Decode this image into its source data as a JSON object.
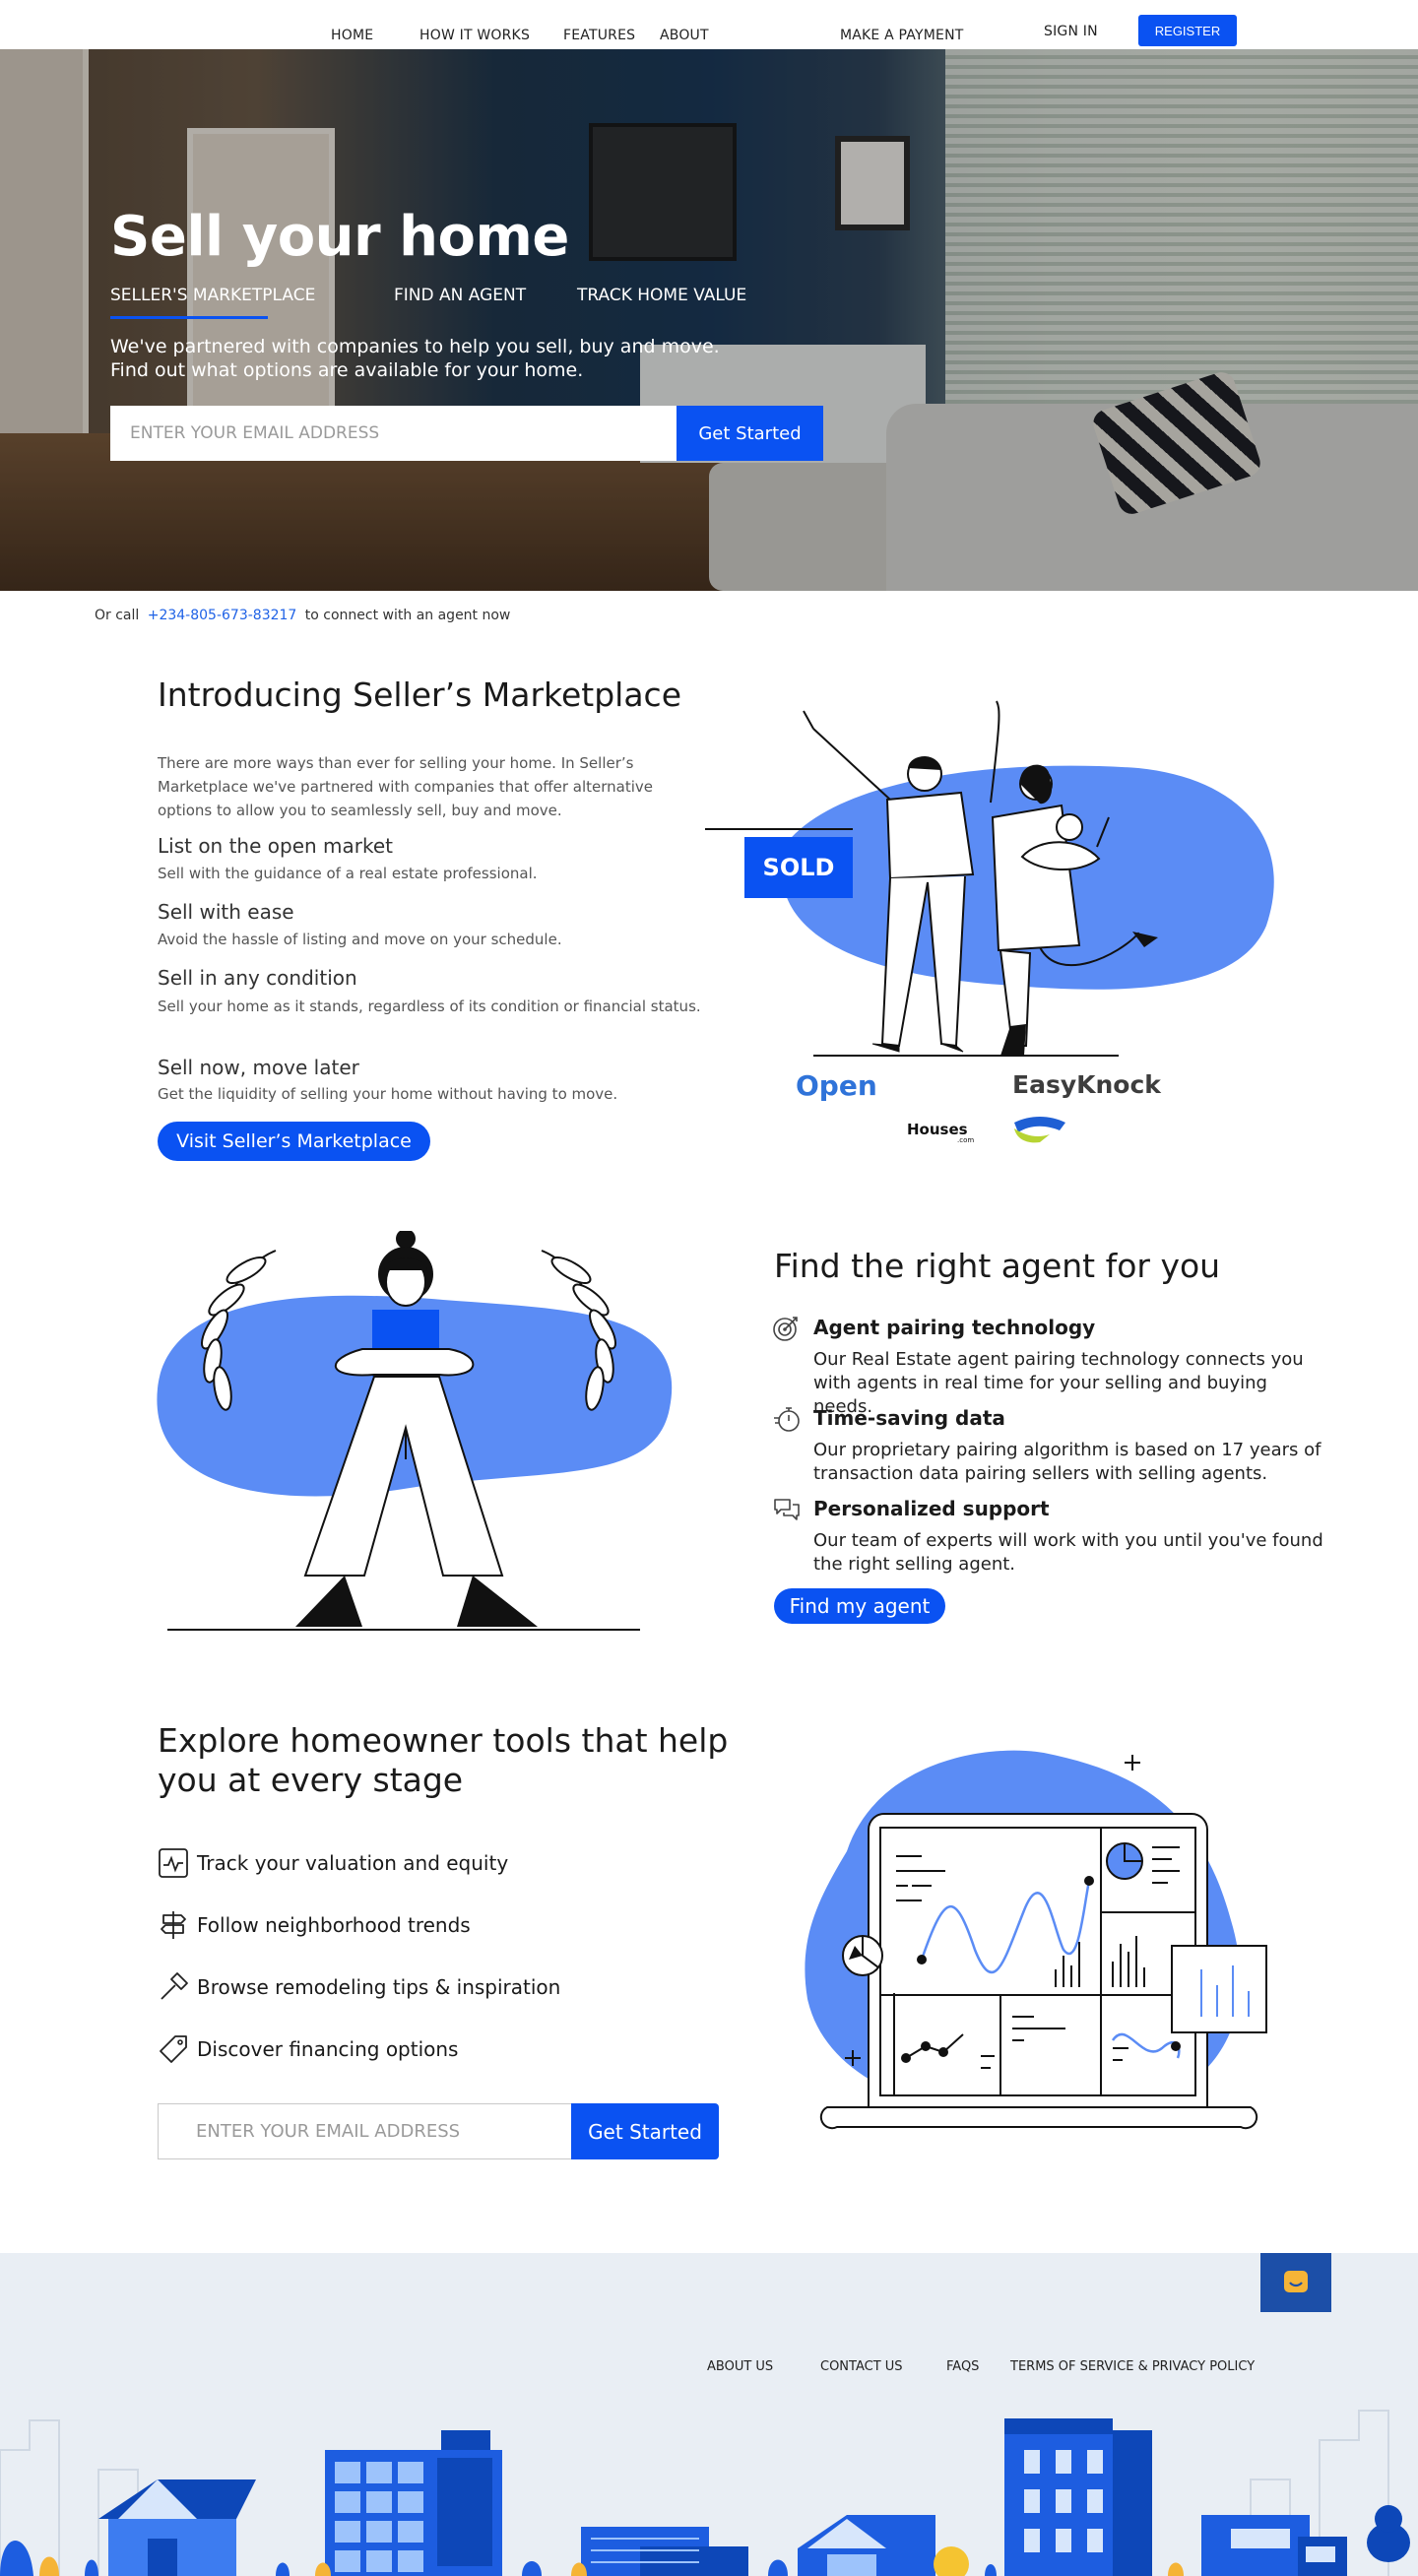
{
  "nav": {
    "home": "HOME",
    "how_it_works": "HOW IT WORKS",
    "features": "FEATURES",
    "about": "ABOUT",
    "make_payment": "MAKE A PAYMENT",
    "sign_in": "SIGN IN",
    "register": "REGISTER"
  },
  "hero": {
    "title": "Sell your home",
    "tabs": [
      "SELLER'S MARKETPLACE",
      "FIND AN AGENT",
      "TRACK HOME VALUE"
    ],
    "active_tab": "SELLER'S MARKETPLACE",
    "description": "We've partnered with companies to help you sell, buy and move. Find out what options are available for your home.",
    "email_placeholder": "ENTER YOUR EMAIL ADDRESS",
    "cta": "Get Started"
  },
  "call": {
    "prefix": "Or call",
    "phone": "+234-805-673-83217",
    "suffix": "to connect with an agent now"
  },
  "marketplace": {
    "title": "Introducing Seller’s Marketplace",
    "intro": "There are more ways than ever for selling your home. In Seller’s Marketplace we've partnered with companies that offer alternative options to allow you to seamlessly sell, buy and move.",
    "items": [
      {
        "heading": "List on the open market",
        "text": "Sell with the guidance of a real estate professional."
      },
      {
        "heading": "Sell with ease",
        "text": "Avoid the hassle of listing and move on your schedule."
      },
      {
        "heading": "Sell in any condition",
        "text": "Sell your home as it stands, regardless of its condition or financial status."
      },
      {
        "heading": "Sell now, move later",
        "text": "Get the liquidity of selling your home without having to move."
      }
    ],
    "button": "Visit Seller’s Marketplace",
    "sign_text": "SOLD",
    "partners": [
      "Open",
      "EasyKnock",
      "Houses"
    ],
    "partners_sub": ".com"
  },
  "agent": {
    "title": "Find the right agent for you",
    "items": [
      {
        "icon": "target-icon",
        "heading": "Agent pairing technology",
        "text": "Our Real Estate agent pairing technology connects you with agents in real time for your selling and buying needs."
      },
      {
        "icon": "stopwatch-icon",
        "heading": "Time-saving data",
        "text": "Our proprietary pairing algorithm is based on 17 years of transaction data pairing sellers with selling agents."
      },
      {
        "icon": "chat-bubbles-icon",
        "heading": "Personalized support",
        "text": "Our team of experts will work with you until you've found the right selling agent."
      }
    ],
    "button": "Find my agent"
  },
  "tools": {
    "title": "Explore homeowner tools that help you at every stage",
    "items": [
      {
        "icon": "chart-line-icon",
        "label": "Track your valuation and equity"
      },
      {
        "icon": "signpost-icon",
        "label": "Follow neighborhood trends"
      },
      {
        "icon": "hammer-icon",
        "label": "Browse remodeling tips & inspiration"
      },
      {
        "icon": "price-tag-icon",
        "label": "Discover financing options"
      }
    ],
    "email_placeholder": "ENTER YOUR EMAIL ADDRESS",
    "cta": "Get Started"
  },
  "footer": {
    "links": [
      "ABOUT US",
      "CONTACT US",
      "FAQS",
      "TERMS OF SERVICE & PRIVACY POLICY"
    ]
  },
  "colors": {
    "accent": "#0a52f2",
    "illustration_blue": "#5b8cf5",
    "footer_bg": "#e9eef4",
    "chat_button": "#1c4fa8",
    "chat_icon": "#f5b437"
  }
}
